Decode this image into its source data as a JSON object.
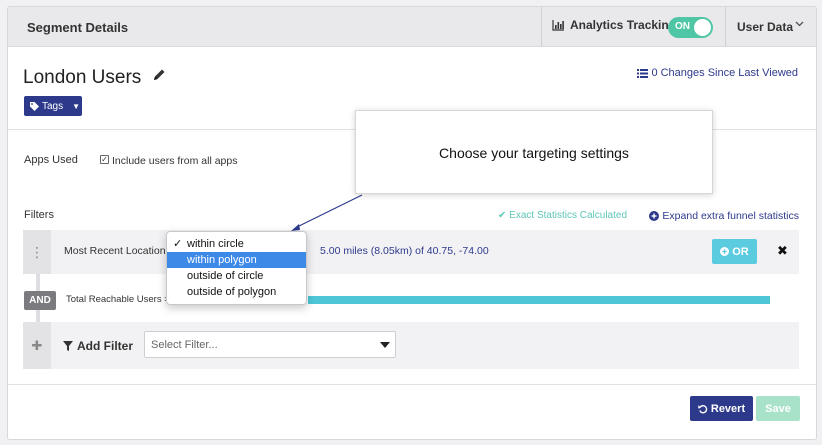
{
  "header": {
    "title": "Segment Details",
    "analytics_label": "Analytics Tracking",
    "analytics_icon": "bar-chart-icon",
    "toggle_label": "ON",
    "user_menu_label": "User Data"
  },
  "segment": {
    "title": "London Users",
    "changes_link": "0 Changes Since Last Viewed",
    "tags_label": "Tags"
  },
  "apps": {
    "label": "Apps Used",
    "checkbox_label": "Include users from all apps",
    "checked": true
  },
  "tooltip": {
    "text": "Choose your targeting settings"
  },
  "filters": {
    "label": "Filters",
    "exact_stats": "Exact Statistics Calculated",
    "expand_link": "Expand extra funnel statistics",
    "rows": [
      {
        "label": "Most Recent Location",
        "value": "5.00 miles (8.05km) of 40.75, -74.00",
        "or_label": "OR",
        "remove_glyph": "✖"
      }
    ],
    "dropdown": {
      "options": [
        "within circle",
        "within polygon",
        "outside of circle",
        "outside of polygon"
      ],
      "checked": "within circle",
      "highlighted": "within polygon"
    },
    "and_label": "AND",
    "reach_label": "Total Reachable Users =",
    "add_label": "Add Filter",
    "select_placeholder": "Select Filter..."
  },
  "footer": {
    "revert_label": "Revert",
    "save_label": "Save"
  },
  "colors": {
    "primary": "#2d3a8c",
    "toggle_on": "#4fc6a6",
    "or_button": "#5bcbe0",
    "reach_bar": "#4ec6d7",
    "save_disabled": "#a7e2c9",
    "dropdown_highlight": "#3d89e8"
  }
}
